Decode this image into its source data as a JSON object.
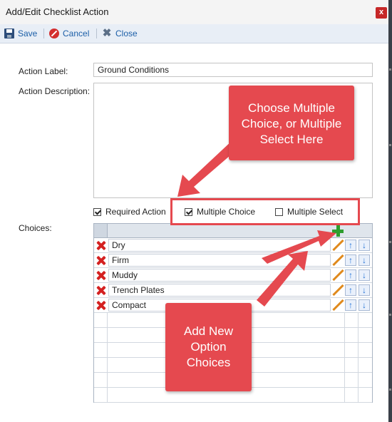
{
  "window": {
    "title": "Add/Edit Checklist Action",
    "close_glyph": "x"
  },
  "toolbar": {
    "save_label": "Save",
    "cancel_label": "Cancel",
    "close_label": "Close"
  },
  "form": {
    "action_label_label": "Action Label:",
    "action_label_value": "Ground Conditions",
    "action_description_label": "Action Description:",
    "action_description_value": "",
    "required_action_label": "Required Action",
    "required_action_checked": true,
    "multiple_choice_label": "Multiple Choice",
    "multiple_choice_checked": true,
    "multiple_select_label": "Multiple Select",
    "multiple_select_checked": false,
    "choices_label": "Choices:"
  },
  "choices": [
    "Dry",
    "Firm",
    "Muddy",
    "Trench Plates",
    "Compact"
  ],
  "annotations": {
    "top": "Choose Multiple Choice, or Multiple Select Here",
    "bottom": "Add New Option Choices"
  },
  "colors": {
    "annotation": "#e5494f",
    "link": "#1c5fa8",
    "delete": "#d42020",
    "add": "#2e9e2e"
  },
  "icons": [
    "save-icon",
    "cancel-icon",
    "close-icon",
    "add-icon",
    "delete-icon",
    "edit-icon",
    "move-up-icon",
    "move-down-icon"
  ]
}
